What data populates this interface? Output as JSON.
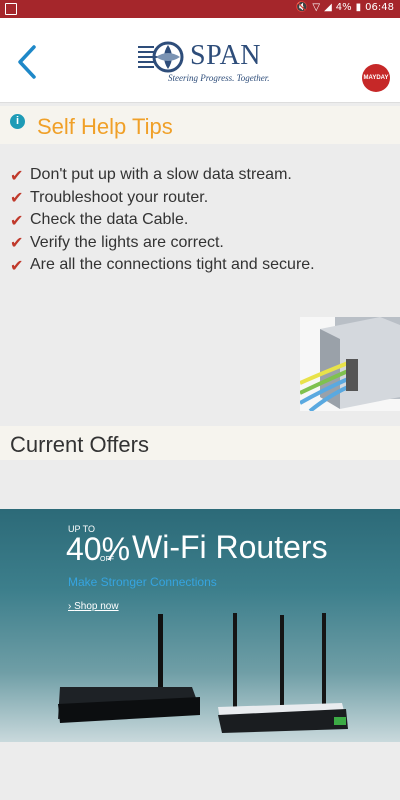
{
  "status_bar": {
    "battery": "4%",
    "time": "06:48"
  },
  "header": {
    "logo_word": "SPAN",
    "logo_tagline": "Steering Progress. Together.",
    "mayday_text": "MAYDAY"
  },
  "tips": {
    "title": "Self Help Tips",
    "items": [
      "Don't put up with a slow data stream.",
      "Troubleshoot your router.",
      "Check the data Cable.",
      "Verify the lights are correct.",
      "Are all the connections tight and secure."
    ]
  },
  "offers": {
    "title": "Current Offers",
    "banner": {
      "up_to": "UP TO",
      "percent": "40%",
      "off": "OFF",
      "headline": "Wi-Fi Routers",
      "subtitle": "Make Stronger Connections",
      "cta": "Shop now"
    }
  },
  "colors": {
    "status_bar": "#a5262b",
    "tips_title": "#f0a028",
    "check": "#c0392b",
    "back_arrow": "#1e88c8"
  }
}
